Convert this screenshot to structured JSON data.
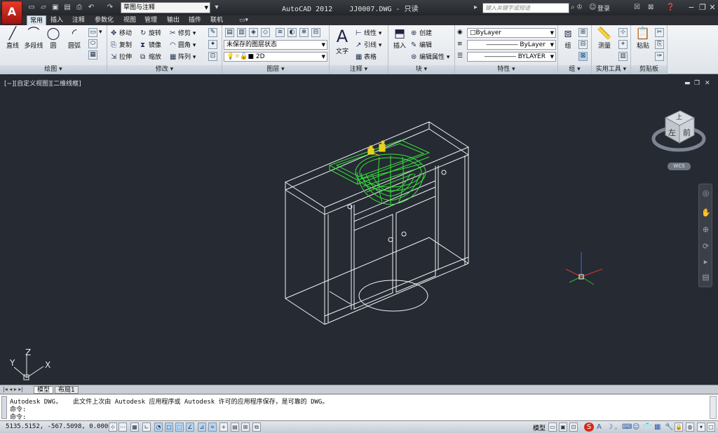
{
  "titlebar": {
    "app_icon": "A",
    "workspace": "草图与注释",
    "title": "AutoCAD 2012    JJ0007.DWG - 只读",
    "search_placeholder": "键入关键字或短语",
    "login": "登录"
  },
  "tabs": [
    "常用",
    "插入",
    "注释",
    "参数化",
    "视图",
    "管理",
    "输出",
    "插件",
    "联机"
  ],
  "ribbon": {
    "draw": {
      "title": "绘图 ▾",
      "line": "直线",
      "polyline": "多段线",
      "circle": "圆",
      "arc": "圆弧"
    },
    "modify": {
      "title": "修改 ▾",
      "move": "移动",
      "rotate": "旋转",
      "trim": "修剪",
      "copy": "复制",
      "mirror": "镜像",
      "fillet": "圆角",
      "stretch": "拉伸",
      "scale": "缩放",
      "array": "阵列"
    },
    "layers": {
      "title": "图层 ▾",
      "layer_state": "未保存的图层状态",
      "current_layer": "2D"
    },
    "annotation": {
      "title": "注释 ▾",
      "text": "文字",
      "dimension": "线性",
      "leader": "引线",
      "table": "表格"
    },
    "block": {
      "title": "块 ▾",
      "insert": "插入",
      "create": "创建",
      "edit": "编辑",
      "edit_attr": "编辑属性"
    },
    "properties": {
      "title": "特性 ▾",
      "color": "ByLayer",
      "linetype": "ByLayer",
      "lineweight": "BYLAYER"
    },
    "groups": {
      "title": "组 ▾",
      "group": "组"
    },
    "utilities": {
      "title": "实用工具 ▾",
      "measure": "测量"
    },
    "clipboard": {
      "title": "剪贴板",
      "paste": "粘贴"
    }
  },
  "viewport": {
    "label": "[−][自定义视图][二维线框]",
    "wcs": "WCS",
    "viewcube_top": "上",
    "viewcube_front": "前",
    "viewcube_left": "左",
    "axis_x": "X",
    "axis_y": "Y",
    "axis_z": "Z"
  },
  "layout_tabs": [
    "模型",
    "布局1"
  ],
  "command": {
    "line1": "Autodesk DWG，   此文件上次由 Autodesk 应用程序或 Autodesk 许可的应用程序保存，是可靠的 DWG。",
    "line2": "命令:",
    "line3": "命令:"
  },
  "status": {
    "coords": "5135.5152, -567.5098, 0.0000",
    "model": "模型"
  },
  "colors": {
    "accent_red": "#d42a1c",
    "viewport_bg": "#252a33",
    "sink": "#35e03a",
    "faucet": "#e8d020"
  }
}
